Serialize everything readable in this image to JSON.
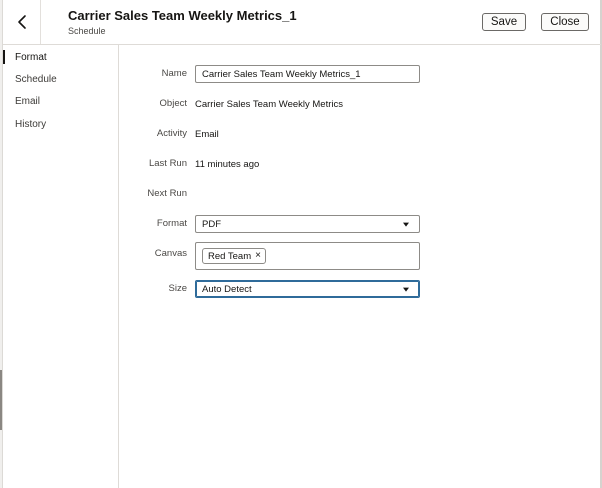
{
  "header": {
    "title": "Carrier Sales Team Weekly Metrics_1",
    "subtitle": "Schedule",
    "save_label": "Save",
    "close_label": "Close",
    "back_icon": "chevron-left-icon"
  },
  "sidebar": {
    "items": [
      {
        "label": "Format",
        "active": true
      },
      {
        "label": "Schedule",
        "active": false
      },
      {
        "label": "Email",
        "active": false
      },
      {
        "label": "History",
        "active": false
      }
    ]
  },
  "form": {
    "name": {
      "label": "Name",
      "value": "Carrier Sales Team Weekly Metrics_1"
    },
    "object": {
      "label": "Object",
      "value": "Carrier Sales Team Weekly Metrics"
    },
    "activity": {
      "label": "Activity",
      "value": "Email"
    },
    "last_run": {
      "label": "Last Run",
      "value": "11 minutes ago"
    },
    "next_run": {
      "label": "Next Run",
      "value": ""
    },
    "format": {
      "label": "Format",
      "value": "PDF"
    },
    "canvas": {
      "label": "Canvas",
      "chips": [
        {
          "label": "Red Team",
          "remove_icon": "close-icon"
        }
      ]
    },
    "size": {
      "label": "Size",
      "value": "Auto Detect"
    }
  },
  "colors": {
    "focus_border": "#2f6b9a",
    "text": "#161513",
    "muted_text": "#4a4845"
  }
}
